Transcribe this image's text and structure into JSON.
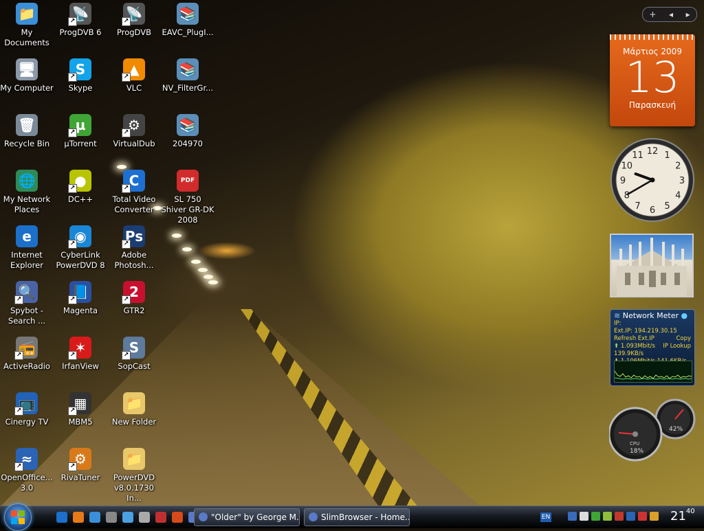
{
  "desktop": {
    "icons": [
      {
        "label": "My Documents",
        "icon": "folder-documents-icon",
        "color": "#3a8fd8",
        "glyph": "📁",
        "shortcut": false
      },
      {
        "label": "ProgDVB 6",
        "icon": "satellite-dish-icon",
        "color": "#555",
        "glyph": "📡",
        "shortcut": true
      },
      {
        "label": "ProgDVB",
        "icon": "satellite-dish-icon",
        "color": "#555",
        "glyph": "📡",
        "shortcut": true
      },
      {
        "label": "EAVC_PlugI...",
        "icon": "archive-books-icon",
        "color": "#5b8fb8",
        "glyph": "📚",
        "shortcut": false
      },
      {
        "label": "My Computer",
        "icon": "computer-icon",
        "color": "#8a99aa",
        "glyph": "🖥",
        "shortcut": false
      },
      {
        "label": "Skype",
        "icon": "skype-icon",
        "color": "#13a3e8",
        "glyph": "S",
        "shortcut": true
      },
      {
        "label": "VLC",
        "icon": "vlc-cone-icon",
        "color": "#f08a00",
        "glyph": "▲",
        "shortcut": true
      },
      {
        "label": "NV_FilterGr...",
        "icon": "archive-books-icon",
        "color": "#5b8fb8",
        "glyph": "📚",
        "shortcut": false
      },
      {
        "label": "Recycle Bin",
        "icon": "recycle-bin-icon",
        "color": "#7a8a99",
        "glyph": "🗑",
        "shortcut": false
      },
      {
        "label": "µTorrent",
        "icon": "utorrent-icon",
        "color": "#3fa535",
        "glyph": "µ",
        "shortcut": true
      },
      {
        "label": "VirtualDub",
        "icon": "gear-icon",
        "color": "#444",
        "glyph": "⚙",
        "shortcut": true
      },
      {
        "label": "204970",
        "icon": "archive-books-icon",
        "color": "#5b8fb8",
        "glyph": "📚",
        "shortcut": false
      },
      {
        "label": "My Network Places",
        "icon": "network-globe-icon",
        "color": "#2e8b57",
        "glyph": "🌐",
        "shortcut": false
      },
      {
        "label": "DC++",
        "icon": "dcpp-icon",
        "color": "#b8c400",
        "glyph": "●",
        "shortcut": true
      },
      {
        "label": "Total Video Converter",
        "icon": "video-converter-icon",
        "color": "#1d6fd1",
        "glyph": "C",
        "shortcut": true
      },
      {
        "label": "SL 750 Shiver GR-DK 2008",
        "icon": "pdf-icon",
        "color": "#d12b2b",
        "glyph": "PDF",
        "shortcut": false
      },
      {
        "label": "Internet Explorer",
        "icon": "internet-explorer-icon",
        "color": "#1b70c9",
        "glyph": "e",
        "shortcut": false
      },
      {
        "label": "CyberLink PowerDVD 8",
        "icon": "powerdvd-icon",
        "color": "#1a86d6",
        "glyph": "◉",
        "shortcut": true
      },
      {
        "label": "Adobe Photosh...",
        "icon": "photoshop-icon",
        "color": "#1b3d73",
        "glyph": "Ps",
        "shortcut": true
      },
      {
        "label": "",
        "icon": "",
        "color": "",
        "glyph": "",
        "shortcut": false
      },
      {
        "label": "Spybot - Search ...",
        "icon": "spybot-icon",
        "color": "#4a63a5",
        "glyph": "🔍",
        "shortcut": true
      },
      {
        "label": "Magenta",
        "icon": "books-icon",
        "color": "#2b4fa0",
        "glyph": "📘",
        "shortcut": true
      },
      {
        "label": "GTR2",
        "icon": "gtr2-icon",
        "color": "#c8102e",
        "glyph": "2",
        "shortcut": true
      },
      {
        "label": "",
        "icon": "",
        "color": "",
        "glyph": "",
        "shortcut": false
      },
      {
        "label": "ActiveRadio",
        "icon": "radio-icon",
        "color": "#777",
        "glyph": "📻",
        "shortcut": true
      },
      {
        "label": "IrfanView",
        "icon": "irfanview-icon",
        "color": "#d91a1a",
        "glyph": "✶",
        "shortcut": true
      },
      {
        "label": "SopCast",
        "icon": "sopcast-icon",
        "color": "#5e7a9c",
        "glyph": "S",
        "shortcut": true
      },
      {
        "label": "",
        "icon": "",
        "color": "",
        "glyph": "",
        "shortcut": false
      },
      {
        "label": "Cinergy TV",
        "icon": "tv-icon",
        "color": "#2262b8",
        "glyph": "📺",
        "shortcut": true
      },
      {
        "label": "MBM5",
        "icon": "chip-icon",
        "color": "#333",
        "glyph": "▦",
        "shortcut": true
      },
      {
        "label": "New Folder",
        "icon": "folder-icon",
        "color": "#e8c86a",
        "glyph": "📁",
        "shortcut": false
      },
      {
        "label": "",
        "icon": "",
        "color": "",
        "glyph": "",
        "shortcut": false
      },
      {
        "label": "OpenOffice... 3.0",
        "icon": "openoffice-icon",
        "color": "#2b63b5",
        "glyph": "≈",
        "shortcut": true
      },
      {
        "label": "RivaTuner",
        "icon": "rivatuner-gear-icon",
        "color": "#d97a1a",
        "glyph": "⚙",
        "shortcut": true
      },
      {
        "label": "PowerDVD v8.0.1730 In...",
        "icon": "folder-icon",
        "color": "#e8c86a",
        "glyph": "📁",
        "shortcut": false
      }
    ]
  },
  "sidebar": {
    "controls": {
      "add": "+",
      "prev": "◂",
      "next": "▸"
    },
    "calendar": {
      "month": "Μάρτιος 2009",
      "day": "13",
      "weekday": "Παρασκευή"
    },
    "clock": {
      "hours": 9,
      "minutes": 40
    },
    "network_meter": {
      "title": "Network Meter",
      "ip_label": "IP:",
      "ext_ip": "Ext.IP: 194.219.30.15",
      "copy": "Copy",
      "refresh": "Refresh Ext.IP",
      "lookup": "IP Lookup",
      "up_speed": "1.093Mbit/s",
      "up_rate": "139.9KB/s",
      "down_speed": "1.106Mbit/s",
      "down_rate": "141.6KB/s"
    },
    "gauges": {
      "cpu_label": "CPU",
      "cpu": "18%",
      "ram": "42%"
    }
  },
  "taskbar": {
    "tasks": [
      {
        "label": "\"Older\" by George M..."
      },
      {
        "label": "SlimBrowser - Home..."
      }
    ],
    "language": "EN",
    "time_hour": "21",
    "time_min": "40",
    "colors": {
      "ql": [
        "#1b70c9",
        "#e8791b",
        "#3a8fd8",
        "#888",
        "#4aa0e0",
        "#aaa",
        "#c03030",
        "#d84a1a",
        "#5a79c8"
      ],
      "tray": [
        "#3b6bb8",
        "#dcdcdc",
        "#3fa535",
        "#8fbf3a",
        "#c0392b",
        "#2b63b5",
        "#cc3333",
        "#d8a02a"
      ]
    }
  }
}
